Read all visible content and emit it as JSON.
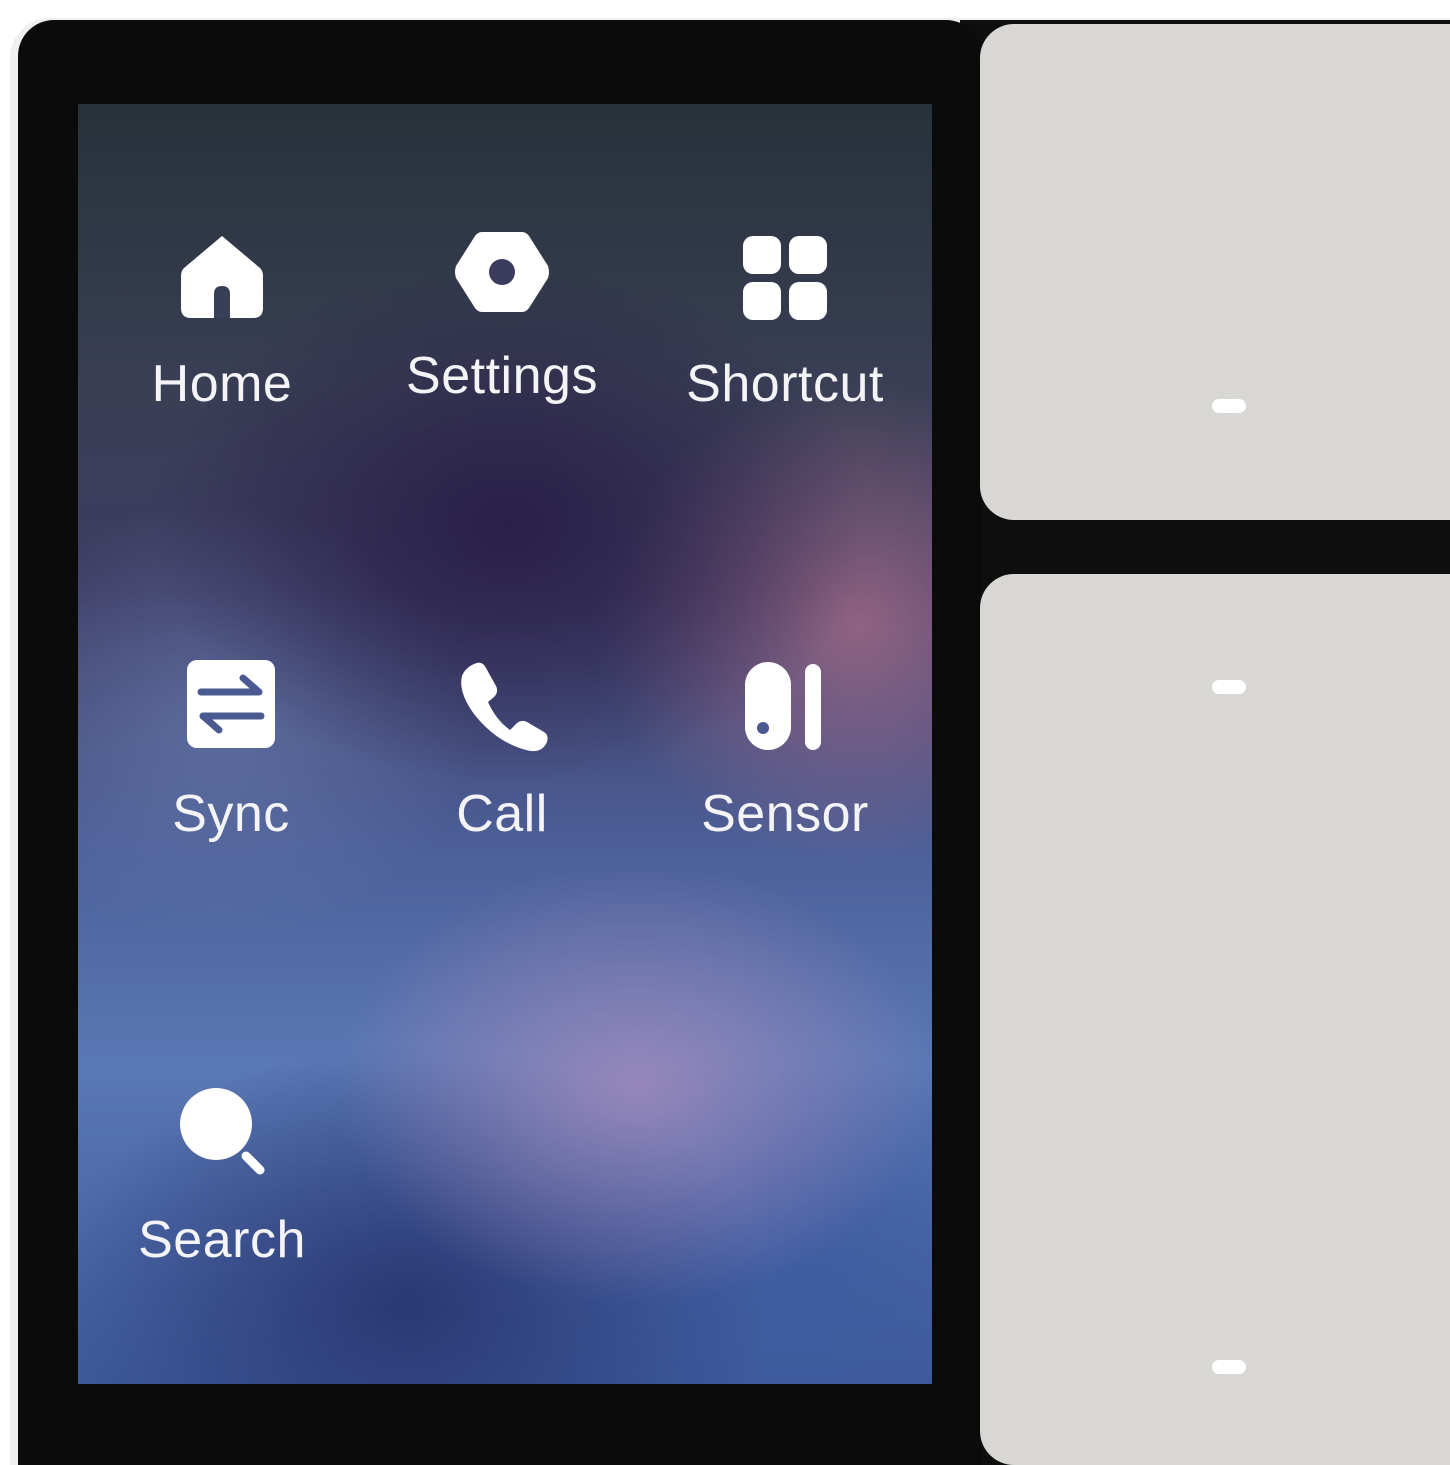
{
  "screen": {
    "apps": [
      {
        "label": "Home",
        "icon": "home-icon"
      },
      {
        "label": "Settings",
        "icon": "settings-icon"
      },
      {
        "label": "Shortcut",
        "icon": "grid-icon"
      },
      {
        "label": "Sync",
        "icon": "sync-icon"
      },
      {
        "label": "Call",
        "icon": "phone-icon"
      },
      {
        "label": "Sensor",
        "icon": "sensor-icon"
      },
      {
        "label": "Search",
        "icon": "search-icon"
      }
    ]
  },
  "colors": {
    "frame": "#0b0b0b",
    "key": "#d8d7d3",
    "indicator": "#ffffff",
    "label": "#f4f4f6"
  }
}
